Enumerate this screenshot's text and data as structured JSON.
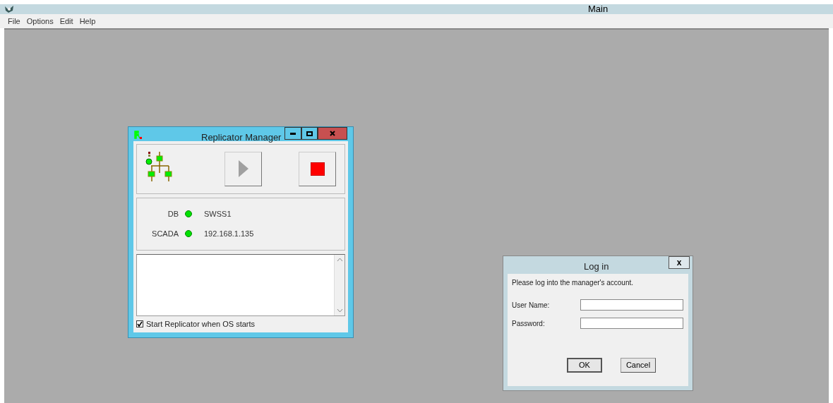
{
  "window": {
    "title": "Main"
  },
  "menu": [
    "File",
    "Options",
    "Edit",
    "Help"
  ],
  "replicator": {
    "title": "Replicator Manager",
    "connections": [
      {
        "label": "DB",
        "color": "#00e000",
        "value": "SWSS1"
      },
      {
        "label": "SCADA",
        "color": "#00e000",
        "value": "192.168.1.135"
      }
    ],
    "autostart": {
      "label": "Start Replicator when OS starts",
      "checked": true
    }
  },
  "login": {
    "title": "Log in",
    "message": "Please log into the manager's account.",
    "fields": [
      {
        "label": "User Name:"
      },
      {
        "label": "Password:"
      }
    ],
    "buttons": [
      "OK",
      "Cancel"
    ],
    "close": "x"
  }
}
